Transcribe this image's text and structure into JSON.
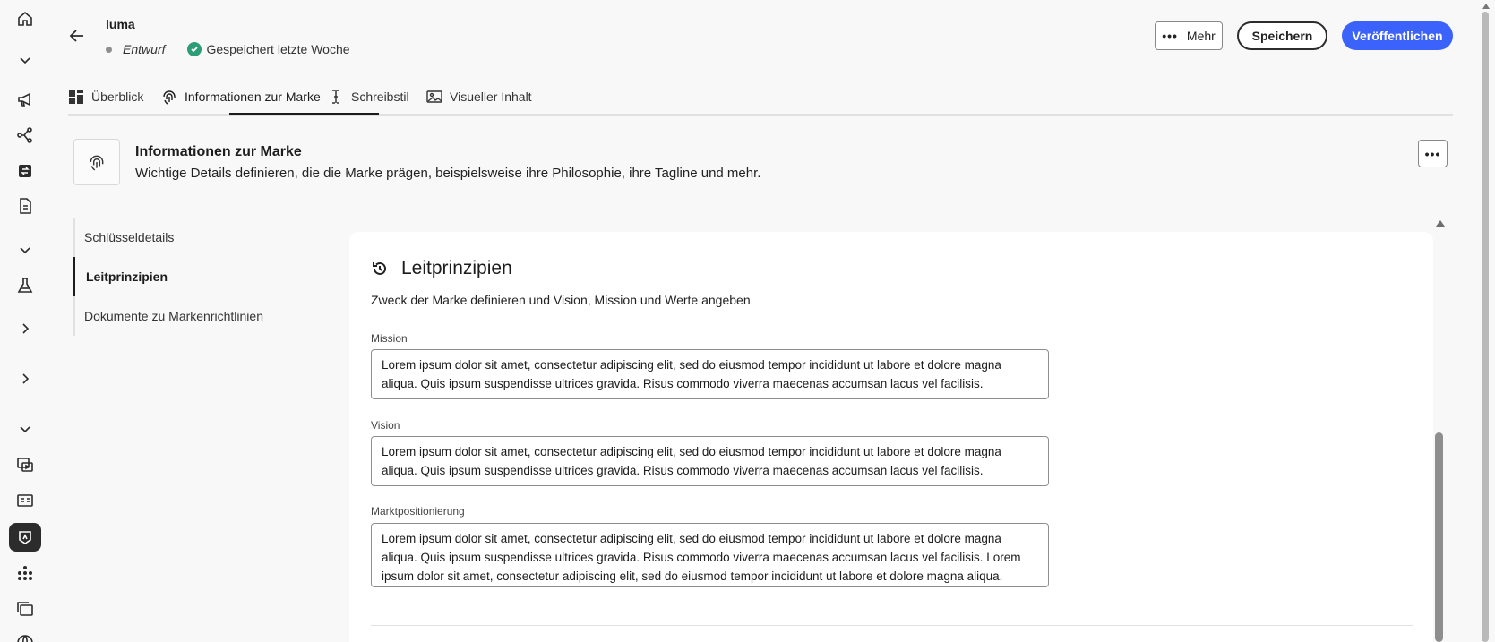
{
  "header": {
    "title": "luma_",
    "status_draft": "Entwurf",
    "status_saved": "Gespeichert letzte Woche",
    "more_label": "Mehr",
    "save_label": "Speichern",
    "publish_label": "Veröffentlichen"
  },
  "tabs": [
    {
      "label": "Überblick",
      "icon": "dashboard-icon"
    },
    {
      "label": "Informationen zur Marke",
      "icon": "fingerprint-icon",
      "active": true
    },
    {
      "label": "Schreibstil",
      "icon": "text-cursor-icon"
    },
    {
      "label": "Visueller Inhalt",
      "icon": "image-icon"
    }
  ],
  "section": {
    "title": "Informationen zur Marke",
    "description": "Wichtige Details definieren, die die Marke prägen, beispielsweise ihre Philosophie, ihre Tagline und mehr."
  },
  "sidenav": [
    {
      "label": "Schlüsseldetails"
    },
    {
      "label": "Leitprinzipien",
      "active": true
    },
    {
      "label": "Dokumente zu Markenrichtlinien"
    }
  ],
  "card": {
    "title": "Leitprinzipien",
    "subtitle": "Zweck der Marke definieren und Vision, Mission und Werte angeben",
    "fields": [
      {
        "label": "Mission",
        "value": "Lorem ipsum dolor sit amet, consectetur adipiscing elit, sed do eiusmod tempor incididunt ut labore et dolore magna aliqua. Quis ipsum suspendisse ultrices gravida. Risus commodo viverra maecenas accumsan lacus vel facilisis."
      },
      {
        "label": "Vision",
        "value": "Lorem ipsum dolor sit amet, consectetur adipiscing elit, sed do eiusmod tempor incididunt ut labore et dolore magna aliqua. Quis ipsum suspendisse ultrices gravida. Risus commodo viverra maecenas accumsan lacus vel facilisis."
      },
      {
        "label": "Marktpositionierung",
        "value": "Lorem ipsum dolor sit amet, consectetur adipiscing elit, sed do eiusmod tempor incididunt ut labore et dolore magna aliqua. Quis ipsum suspendisse ultrices gravida. Risus commodo viverra maecenas accumsan lacus vel facilisis. Lorem ipsum dolor sit amet, consectetur adipiscing elit, sed do eiusmod tempor incididunt ut labore et dolore magna aliqua."
      }
    ]
  },
  "rail_icons": [
    "home-icon",
    "chevron-down-icon",
    "megaphone-icon",
    "journey-icon",
    "content-swap-icon",
    "document-icon",
    "chevron-down-icon",
    "beaker-icon",
    "chevron-right-icon",
    "chevron-right-icon",
    "chevron-down-icon",
    "media-icon",
    "form-icon",
    "brand-icon",
    "components-icon",
    "folders-icon",
    "globe-icon"
  ],
  "colors": {
    "accent": "#3b63fb",
    "success": "#2d9d78"
  }
}
